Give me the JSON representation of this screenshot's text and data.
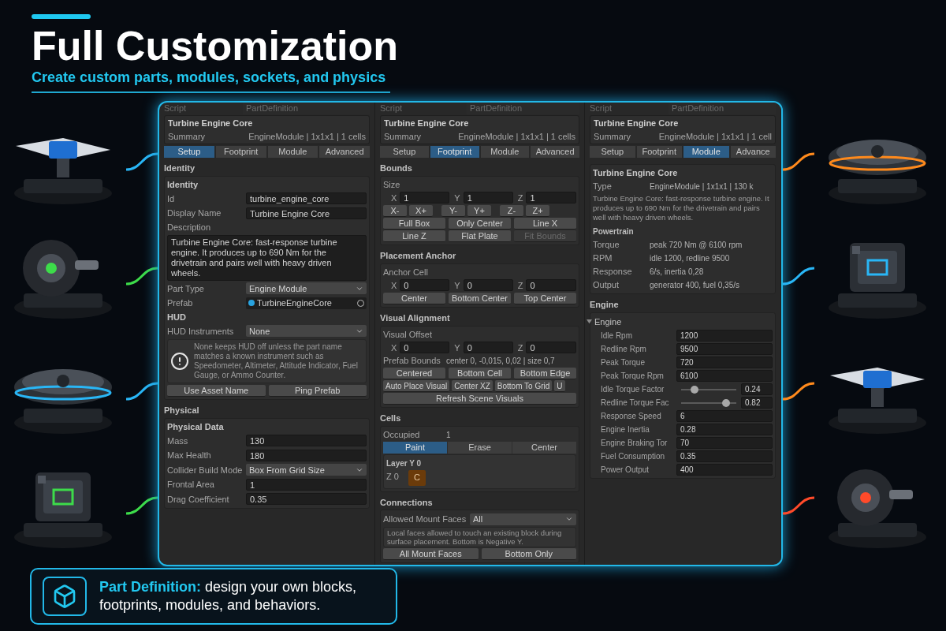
{
  "hero": {
    "title": "Full Customization",
    "subtitle": "Create custom parts, modules, sockets, and physics"
  },
  "panels": [
    {
      "script": {
        "label": "Script",
        "value": "PartDefinition"
      },
      "header": {
        "title": "Turbine Engine Core",
        "summary_label": "Summary",
        "summary_value": "EngineModule | 1x1x1 | 1 cells"
      },
      "tabs": [
        {
          "label": "Setup",
          "selected": true
        },
        {
          "label": "Footprint",
          "selected": false
        },
        {
          "label": "Module",
          "selected": false
        },
        {
          "label": "Advanced",
          "selected": false
        }
      ],
      "sections": [
        {
          "title": "Identity",
          "rows": [
            {
              "kind": "heading",
              "text": "Identity"
            },
            {
              "kind": "field",
              "label": "Id",
              "value": "turbine_engine_core"
            },
            {
              "kind": "field",
              "label": "Display Name",
              "value": "Turbine Engine Core"
            },
            {
              "kind": "label",
              "text": "Description"
            },
            {
              "kind": "textarea",
              "value": "Turbine Engine Core: fast-response turbine engine. It produces up to 690 Nm for the drivetrain and pairs well with heavy driven wheels."
            },
            {
              "kind": "dropdown",
              "label": "Part Type",
              "value": "Engine Module"
            },
            {
              "kind": "object",
              "label": "Prefab",
              "value": "TurbineEngineCore"
            },
            {
              "kind": "heading",
              "text": "HUD"
            },
            {
              "kind": "dropdown",
              "label": "HUD Instruments",
              "value": "None"
            },
            {
              "kind": "help",
              "text": "None keeps HUD off unless the part name matches a known instrument such as Speedometer, Altimeter, Attitude Indicator, Fuel Gauge, or Ammo Counter."
            },
            {
              "kind": "buttons",
              "buttons": [
                {
                  "label": "Use Asset Name"
                },
                {
                  "label": "Ping Prefab"
                }
              ]
            }
          ]
        },
        {
          "title": "Physical",
          "rows": [
            {
              "kind": "heading",
              "text": "Physical Data"
            },
            {
              "kind": "field",
              "label": "Mass",
              "value": "130"
            },
            {
              "kind": "field",
              "label": "Max Health",
              "value": "180"
            },
            {
              "kind": "dropdown",
              "label": "Collider Build Mode",
              "value": "Box From Grid Size"
            },
            {
              "kind": "field",
              "label": "Frontal Area",
              "value": "1"
            },
            {
              "kind": "field",
              "label": "Drag Coefficient",
              "value": "0.35"
            }
          ]
        }
      ]
    },
    {
      "script": {
        "label": "Script",
        "value": "PartDefinition"
      },
      "header": {
        "title": "Turbine Engine Core",
        "summary_label": "Summary",
        "summary_value": "EngineModule | 1x1x1 | 1 cells"
      },
      "tabs": [
        {
          "label": "Setup",
          "selected": false
        },
        {
          "label": "Footprint",
          "selected": true
        },
        {
          "label": "Module",
          "selected": false
        },
        {
          "label": "Advanced",
          "selected": false
        }
      ],
      "sections": [
        {
          "title": "Bounds",
          "rows": [
            {
              "kind": "label",
              "text": "Size"
            },
            {
              "kind": "xyz",
              "fields": [
                {
                  "axis": "X",
                  "value": "1"
                },
                {
                  "axis": "Y",
                  "value": "1"
                },
                {
                  "axis": "Z",
                  "value": "1"
                }
              ]
            },
            {
              "kind": "steppers",
              "buttons": [
                {
                  "label": "X-"
                },
                {
                  "label": "X+"
                },
                {
                  "label": "Y-"
                },
                {
                  "label": "Y+"
                },
                {
                  "label": "Z-"
                },
                {
                  "label": "Z+"
                }
              ]
            },
            {
              "kind": "buttons",
              "buttons": [
                {
                  "label": "Full Box"
                },
                {
                  "label": "Only Center"
                },
                {
                  "label": "Line X"
                }
              ]
            },
            {
              "kind": "buttons",
              "buttons": [
                {
                  "label": "Line Z",
                  "disabled": false
                },
                {
                  "label": "Flat Plate",
                  "disabled": false
                },
                {
                  "label": "Fit Bounds",
                  "disabled": true
                }
              ]
            }
          ]
        },
        {
          "title": "Placement Anchor",
          "rows": [
            {
              "kind": "label",
              "text": "Anchor Cell"
            },
            {
              "kind": "xyz",
              "fields": [
                {
                  "axis": "X",
                  "value": "0"
                },
                {
                  "axis": "Y",
                  "value": "0"
                },
                {
                  "axis": "Z",
                  "value": "0"
                }
              ]
            },
            {
              "kind": "buttons",
              "buttons": [
                {
                  "label": "Center"
                },
                {
                  "label": "Bottom Center"
                },
                {
                  "label": "Top Center"
                }
              ]
            }
          ]
        },
        {
          "title": "Visual Alignment",
          "rows": [
            {
              "kind": "label",
              "text": "Visual Offset"
            },
            {
              "kind": "xyz",
              "fields": [
                {
                  "axis": "X",
                  "value": "0"
                },
                {
                  "axis": "Y",
                  "value": "0"
                },
                {
                  "axis": "Z",
                  "value": "0"
                }
              ]
            },
            {
              "kind": "info",
              "label": "Prefab Bounds",
              "value": "center 0, -0,015, 0,02 | size 0,7"
            },
            {
              "kind": "buttons",
              "buttons": [
                {
                  "label": "Centered"
                },
                {
                  "label": "Bottom Cell"
                },
                {
                  "label": "Bottom Edge"
                }
              ]
            },
            {
              "kind": "autobuttons",
              "buttons": [
                {
                  "label": "Auto Place Visual"
                },
                {
                  "label": "Center XZ"
                },
                {
                  "label": "Bottom To Grid"
                },
                {
                  "label": "U"
                }
              ]
            },
            {
              "kind": "buttons",
              "buttons": [
                {
                  "label": "Refresh Scene Visuals"
                }
              ]
            }
          ]
        },
        {
          "title": "Cells",
          "rows": [
            {
              "kind": "info",
              "label": "Occupied",
              "value": "1"
            },
            {
              "kind": "toggles",
              "buttons": [
                {
                  "label": "Paint",
                  "selected": true
                },
                {
                  "label": "Erase",
                  "selected": false
                },
                {
                  "label": "Center",
                  "selected": false
                }
              ]
            },
            {
              "kind": "cells",
              "layer": "Layer Y 0",
              "row": "Z 0",
              "cells": [
                "C"
              ]
            }
          ]
        },
        {
          "title": "Connections",
          "rows": [
            {
              "kind": "dropdown",
              "label": "Allowed Mount Faces",
              "value": "All"
            },
            {
              "kind": "note",
              "text": "Local faces allowed to touch an existing block during surface placement. Bottom is Negative Y."
            },
            {
              "kind": "buttons",
              "buttons": [
                {
                  "label": "All Mount Faces"
                },
                {
                  "label": "Bottom Only"
                }
              ]
            }
          ]
        }
      ]
    },
    {
      "script": {
        "label": "Script",
        "value": "PartDefinition"
      },
      "header": {
        "title": "Turbine Engine Core",
        "summary_label": "Summary",
        "summary_value": "EngineModule | 1x1x1 | 1 cell"
      },
      "tabs": [
        {
          "label": "Setup",
          "selected": false
        },
        {
          "label": "Footprint",
          "selected": false
        },
        {
          "label": "Module",
          "selected": true
        },
        {
          "label": "Advance",
          "selected": false
        }
      ],
      "sections": [
        {
          "rows": [
            {
              "kind": "heading",
              "text": "Turbine Engine Core"
            },
            {
              "kind": "info",
              "label": "Type",
              "value": "EngineModule | 1x1x1 | 130 k"
            },
            {
              "kind": "paragraph",
              "text": "Turbine Engine Core: fast-response turbine engine. It produces up to 690 Nm for the drivetrain and pairs well with heavy driven wheels."
            },
            {
              "kind": "subheading",
              "text": "Powertrain"
            },
            {
              "kind": "info",
              "label": "Torque",
              "value": "peak 720 Nm @ 6100 rpm"
            },
            {
              "kind": "info",
              "label": "RPM",
              "value": "idle 1200, redline 9500"
            },
            {
              "kind": "info",
              "label": "Response",
              "value": "6/s, inertia 0,28"
            },
            {
              "kind": "info",
              "label": "Output",
              "value": "generator 400, fuel 0,35/s"
            }
          ]
        },
        {
          "title": "Engine",
          "rows": [
            {
              "kind": "foldout",
              "label": "Engine",
              "expanded": true,
              "children": [
                {
                  "kind": "field",
                  "label": "Idle Rpm",
                  "value": "1200"
                },
                {
                  "kind": "field",
                  "label": "Redline Rpm",
                  "value": "9500"
                },
                {
                  "kind": "field",
                  "label": "Peak Torque",
                  "value": "720"
                },
                {
                  "kind": "field",
                  "label": "Peak Torque Rpm",
                  "value": "6100"
                },
                {
                  "kind": "slider",
                  "label": "Idle Torque Factor",
                  "level": 0.24,
                  "value": "0.24"
                },
                {
                  "kind": "slider",
                  "label": "Redline Torque Fac",
                  "level": 0.82,
                  "value": "0.82"
                },
                {
                  "kind": "field",
                  "label": "Response Speed",
                  "value": "6"
                },
                {
                  "kind": "field",
                  "label": "Engine Inertia",
                  "value": "0.28"
                },
                {
                  "kind": "field",
                  "label": "Engine Braking Tor",
                  "value": "70"
                },
                {
                  "kind": "field",
                  "label": "Fuel Consumption",
                  "value": "0.35"
                },
                {
                  "kind": "field",
                  "label": "Power Output",
                  "value": "400"
                }
              ]
            }
          ]
        }
      ]
    }
  ],
  "callout": {
    "text": "**Part Definition:** design your own blocks, footprints, modules, and behaviors."
  }
}
